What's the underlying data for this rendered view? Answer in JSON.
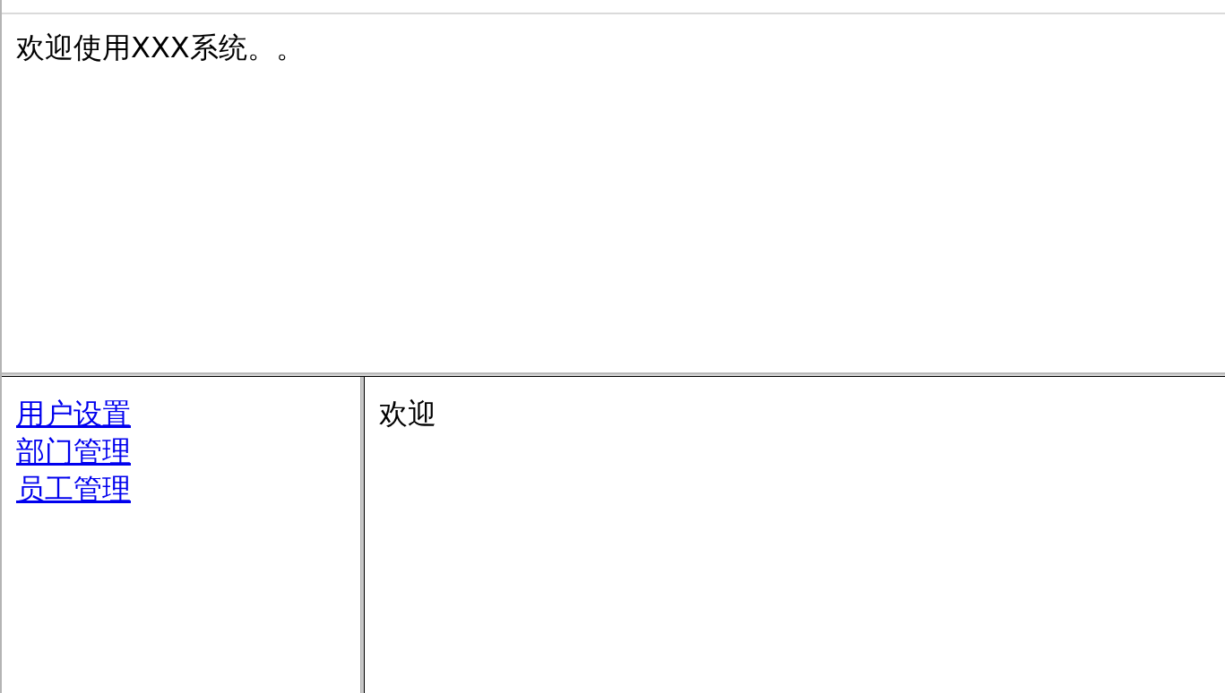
{
  "header_frame": {
    "text": "欢迎使用XXX系统。。"
  },
  "nav_frame": {
    "links": [
      {
        "label": "用户设置"
      },
      {
        "label": "部门管理"
      },
      {
        "label": "员工管理"
      }
    ]
  },
  "main_frame": {
    "text": "欢迎"
  }
}
